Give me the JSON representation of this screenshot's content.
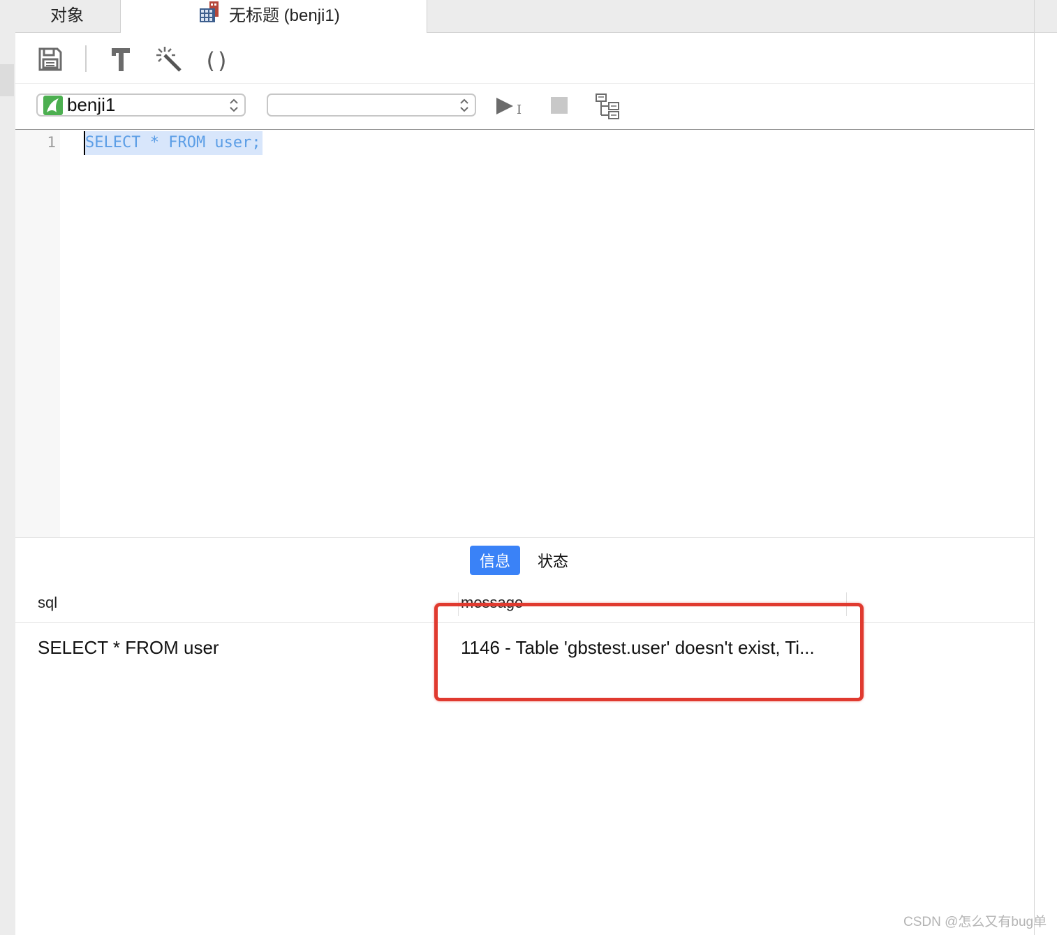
{
  "tabs": {
    "objects_label": "对象",
    "query_label": "无标题 (benji1)"
  },
  "toolbar": {
    "buttons": [
      "save-icon",
      "hammer-icon",
      "magic-wand-icon",
      "parentheses-icon"
    ],
    "parentheses_glyph": "()"
  },
  "connection_bar": {
    "connection_value": "benji1",
    "database_value": "",
    "run_cursor_glyph": "I"
  },
  "editor": {
    "line_number": "1",
    "code": "SELECT * FROM user;"
  },
  "results": {
    "tabs": [
      "信息",
      "状态"
    ],
    "active_tab": "信息",
    "columns": [
      "sql",
      "message"
    ],
    "rows": [
      {
        "sql": "SELECT * FROM user",
        "message": "1146 - Table 'gbstest.user' doesn't exist, Ti..."
      }
    ]
  },
  "colors": {
    "accent": "#3a82f7",
    "highlight_box": "#e03a2f",
    "sql_selected_text": "#5c9ee6",
    "connection_icon": "#4caf50"
  },
  "watermark": "CSDN @怎么又有bug单"
}
